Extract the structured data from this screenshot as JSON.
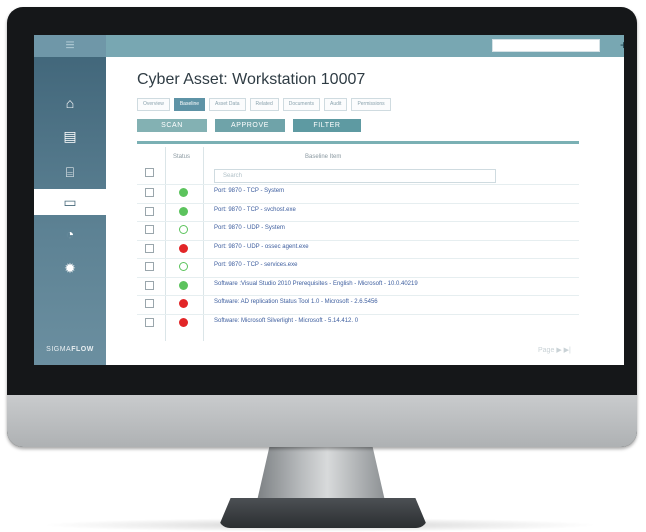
{
  "topbar": {
    "icons": [
      "plus-icon",
      "clock-icon",
      "star-icon"
    ],
    "plus_glyph": "+",
    "clock_glyph": "⊘",
    "star_glyph": "★"
  },
  "sidebar": {
    "menu_glyph": "≡",
    "items": [
      {
        "icon": "home-icon",
        "glyph": "⌂",
        "active": false
      },
      {
        "icon": "document-icon",
        "glyph": "▤",
        "active": false
      },
      {
        "icon": "hierarchy-icon",
        "glyph": "⌸",
        "active": false
      },
      {
        "icon": "briefcase-icon",
        "glyph": "▭",
        "active": true
      },
      {
        "icon": "dashboard-icon",
        "glyph": "◔",
        "active": false
      },
      {
        "icon": "gear-icon",
        "glyph": "✹",
        "active": false
      }
    ],
    "brand_prefix": "SIGMA",
    "brand_suffix": "FLOW"
  },
  "page": {
    "title": "Cyber Asset: Workstation 10007",
    "tabs": [
      "Overview",
      "Baseline",
      "Asset Data",
      "Related",
      "Documents",
      "Audit",
      "Permissions"
    ],
    "active_tab": "Baseline"
  },
  "actions": {
    "scan": "SCAN",
    "approve": "APPROVE",
    "filter": "FILTER"
  },
  "table": {
    "headers": {
      "status": "Status",
      "item": "Baseline Item"
    },
    "search_placeholder": "Search",
    "rows": [
      {
        "status": "green",
        "item": "Port: 9870 - TCP - System"
      },
      {
        "status": "green",
        "item": "Port: 9870 - TCP - svchost.exe"
      },
      {
        "status": "green-outline",
        "item": "Port: 9870 - UDP - System"
      },
      {
        "status": "red",
        "item": "Port: 9870 - UDP - ossec agent.exe"
      },
      {
        "status": "green-outline",
        "item": "Port: 9870 - TCP - services.exe"
      },
      {
        "status": "green",
        "item": "Software :Visual Studio 2010 Prerequisites - English - Microsoft - 10.0.40219"
      },
      {
        "status": "red",
        "item": "Software: AD replication Status Tool 1.0 - Microsoft - 2.6.5456"
      },
      {
        "status": "red",
        "item": "Software: Microsoft Silverlight - Microsoft - 5.14.412. 0"
      }
    ]
  },
  "pager": {
    "label": "Page",
    "next_glyph": "▶",
    "last_glyph": "▶|"
  },
  "colors": {
    "green": "#5cc35d",
    "red": "#e22628",
    "accent": "#78a7b2"
  }
}
